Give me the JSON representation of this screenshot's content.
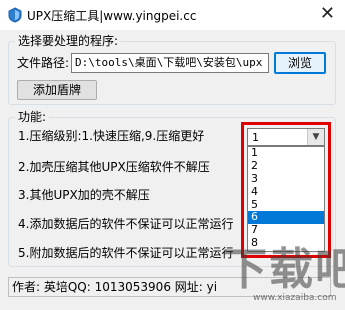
{
  "window": {
    "title": "UPX压缩工具|www.yingpei.cc",
    "close_glyph": "✕"
  },
  "program_group": {
    "title": "选择要处理的程序:",
    "path_label": "文件路径:",
    "path_value": "D:\\tools\\桌面\\下载吧\\安装包\\upx",
    "browse_button": "浏览",
    "shield_button": "添加盾牌"
  },
  "function_group": {
    "title": "功能:",
    "items": [
      "1.压缩级别:1.快速压缩,9.压缩更好",
      "2.加壳压缩其他UPX压缩软件不解压",
      "3.其他UPX加的壳不解压",
      "4.添加数据后的软件不保证可以正常运行",
      "5.附加数据后的软件不保证可以正常运行"
    ]
  },
  "level_select": {
    "value": "1",
    "options": [
      "1",
      "2",
      "3",
      "4",
      "5",
      "6",
      "7",
      "8"
    ],
    "selected_option": "6"
  },
  "status": {
    "text": "作者: 英培QQ: 1013053906 网址: yi"
  },
  "watermark": {
    "logo": "下载吧",
    "url": "www.xiazaiba.com"
  },
  "colors": {
    "highlight": "#e00000",
    "selection": "#0078d7",
    "client_bg": "#f0f0f0"
  }
}
